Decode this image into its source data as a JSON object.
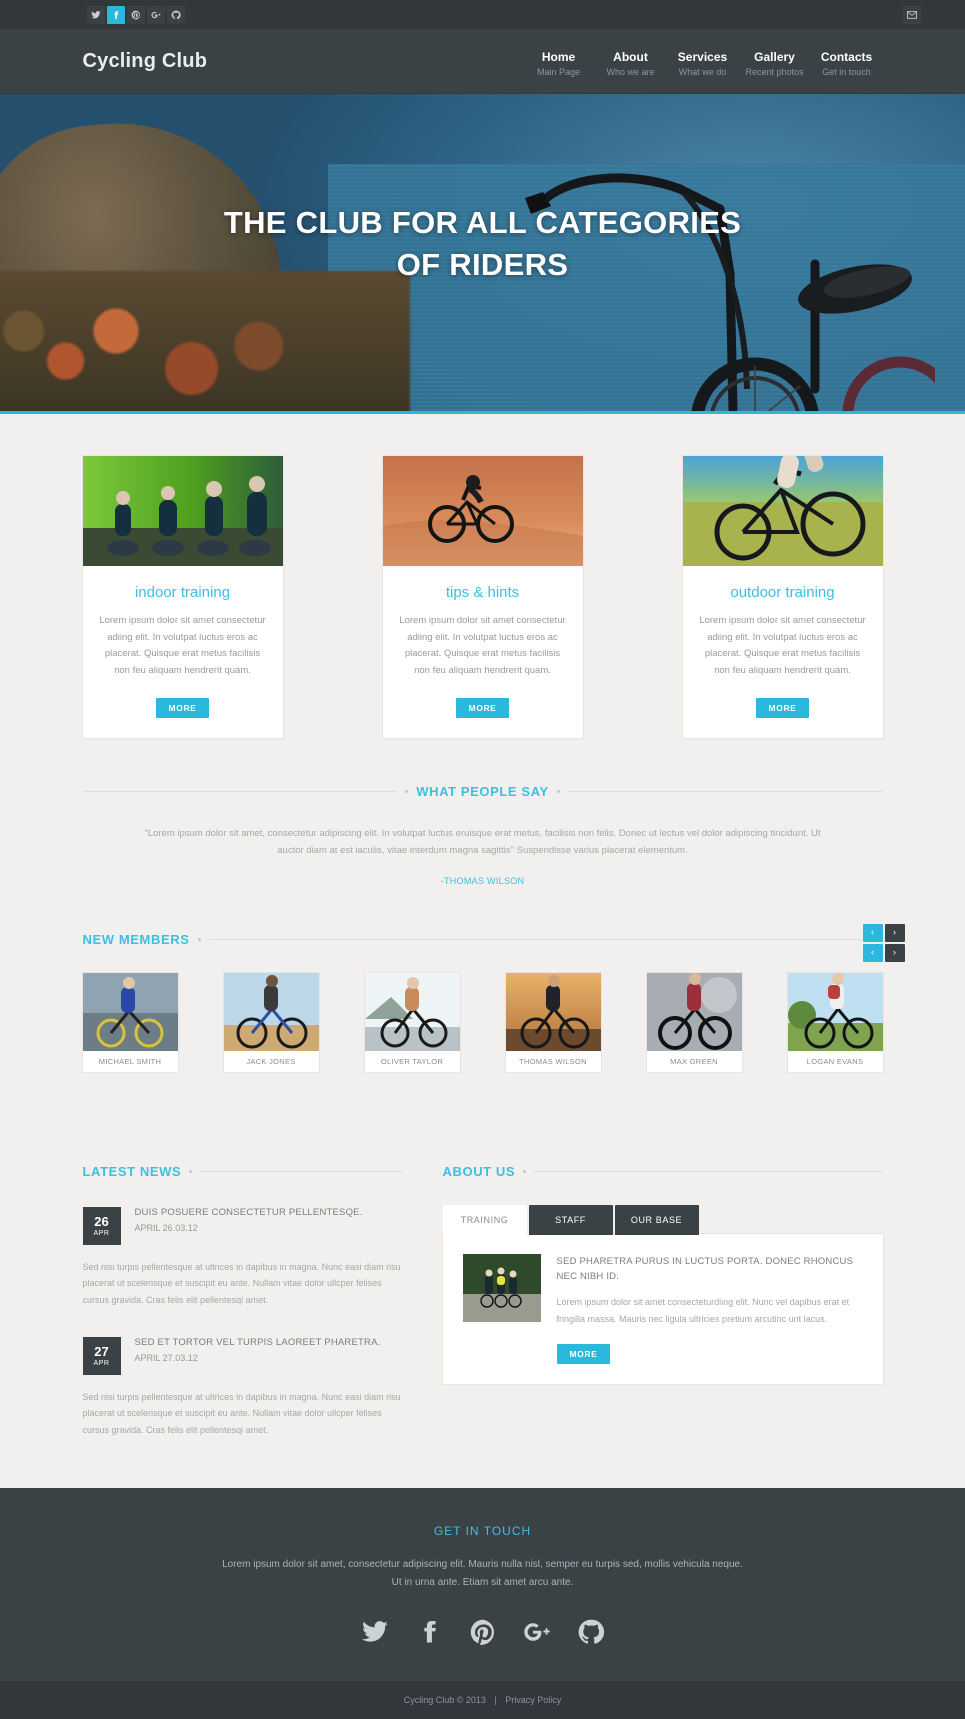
{
  "topbar": {
    "social": [
      {
        "name": "twitter-icon",
        "label": "Twitter",
        "active": false
      },
      {
        "name": "facebook-icon",
        "label": "Facebook",
        "active": true
      },
      {
        "name": "pinterest-icon",
        "label": "Pinterest",
        "active": false
      },
      {
        "name": "googleplus-icon",
        "label": "Google Plus",
        "active": false
      },
      {
        "name": "github-icon",
        "label": "GitHub",
        "active": false
      }
    ],
    "mail_label": "Mail"
  },
  "header": {
    "logo": "Cycling Club",
    "nav": [
      {
        "title": "Home",
        "sub": "Main Page"
      },
      {
        "title": "About",
        "sub": "Who we are"
      },
      {
        "title": "Services",
        "sub": "What we do"
      },
      {
        "title": "Gallery",
        "sub": "Recent photos"
      },
      {
        "title": "Contacts",
        "sub": "Get in touch"
      }
    ]
  },
  "hero": {
    "title_line1": "THE CLUB FOR ALL CATEGORIES",
    "title_line2": "OF RIDERS"
  },
  "cards": [
    {
      "title": "indoor training",
      "text": "Lorem ipsum dolor sit amet consectetur adiing elit. In volutpat luctus eros ac placerat. Quisque erat metus facilisis non feu aliquam hendrerit quam.",
      "button": "MORE"
    },
    {
      "title": "tips & hints",
      "text": "Lorem ipsum dolor sit amet consectetur adiing elit. In volutpat luctus eros ac placerat. Quisque erat metus facilisis non feu aliquam hendrerit quam.",
      "button": "MORE"
    },
    {
      "title": "outdoor training",
      "text": "Lorem ipsum dolor sit amet consectetur adiing elit. In volutpat luctus eros ac placerat. Quisque erat metus facilisis non feu aliquam hendrerit quam.",
      "button": "MORE"
    }
  ],
  "testimonial": {
    "heading": "WHAT PEOPLE SAY",
    "quote": "\"Lorem ipsum dolor sit amet, consectetur adipiscing elit. In volutpat luctus eruisque erat metus, facilisis non felis. Donec ut lectus vel dolor adipiscing tincidunt. Ut auctor diam at est iaculis, vitae interdum magna sagittis\" Suspendisse varius placerat elementum.",
    "author": "-THOMAS WILSON"
  },
  "members": {
    "heading": "NEW MEMBERS",
    "nav": {
      "prev": "‹",
      "next": "›"
    },
    "list": [
      {
        "name": "MICHAEL SMITH"
      },
      {
        "name": "JACK JONES"
      },
      {
        "name": "OLIVER TAYLOR"
      },
      {
        "name": "THOMAS WILSON"
      },
      {
        "name": "MAX GREEN"
      },
      {
        "name": "LOGAN EVANS"
      }
    ]
  },
  "news": {
    "heading": "LATEST NEWS",
    "items": [
      {
        "day": "26",
        "month": "APR",
        "title": "DUIS POSUERE CONSECTETUR PELLENTESQE.",
        "subtitle": "APRIL 26.03.12",
        "body": "Sed nisi turpis pellentesque at ultrices in dapibus in magna. Nunc easi diam risu placerat ut scelerisque et suscipit eu ante. Nullam vitae dolor ullcper felises cursus gravida. Cras felis elit pellentesqi amet."
      },
      {
        "day": "27",
        "month": "APR",
        "title": "SED ET TORTOR VEL TURPIS LAOREET PHARETRA.",
        "subtitle": "APRIL 27.03.12",
        "body": "Sed nisi turpis pellentesque at ultrices in dapibus in magna. Nunc easi diam risu placerat ut scelerisque et suscipit eu ante. Nullam vitae dolor ullcper felises cursus gravida. Cras felis elit pellentesqi amet."
      }
    ]
  },
  "about": {
    "heading": "ABOUT US",
    "tabs": [
      {
        "label": "TRAINING",
        "active": true
      },
      {
        "label": "STAFF",
        "active": false
      },
      {
        "label": "OUR BASE",
        "active": false
      }
    ],
    "panel": {
      "title": "SED PHARETRA PURUS IN LUCTUS PORTA. DONEC RHONCUS NEC NIBH ID.",
      "text": "Lorem ipsum dolor sit amet consecteturdiing elit. Nunc vel dapibus erat et fringilla massa. Mauris nec ligula ultricies pretium arcutinc unt lacus.",
      "button": "MORE"
    }
  },
  "footer": {
    "heading": "GET IN  TOUCH",
    "text_line1": "Lorem ipsum dolor sit amet, consectetur adipiscing elit. Mauris nulla nisl, semper eu turpis sed, mollis vehicula neque.",
    "text_line2": "Ut in urna ante. Etiam sit amet arcu ante.",
    "social": [
      {
        "name": "twitter-icon",
        "label": "Twitter"
      },
      {
        "name": "facebook-icon",
        "label": "Facebook"
      },
      {
        "name": "pinterest-icon",
        "label": "Pinterest"
      },
      {
        "name": "googleplus-icon",
        "label": "Google Plus"
      },
      {
        "name": "github-icon",
        "label": "GitHub"
      }
    ],
    "copyright": "Cycling Club © 2013",
    "separator": "|",
    "privacy": "Privacy Policy"
  },
  "colors": {
    "accent": "#2bb8dd",
    "accent_text": "#3cbfe0",
    "dark": "#3b4246",
    "darker": "#31373b",
    "page_bg": "#f2f0ee"
  }
}
